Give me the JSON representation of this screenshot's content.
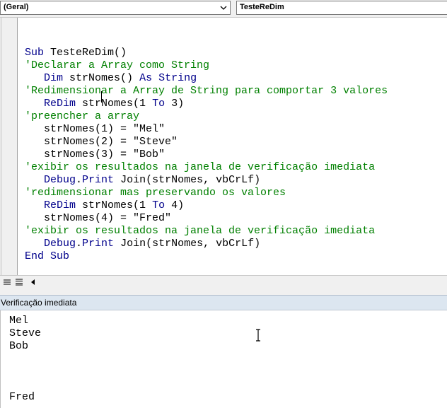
{
  "toolbar": {
    "object_combo": "(Geral)",
    "procedure_combo": "TesteReDim"
  },
  "code_lines": [
    [
      {
        "t": "Sub ",
        "c": "kw"
      },
      {
        "t": "TesteReDim()",
        "c": "pl"
      }
    ],
    [
      {
        "t": "'Declarar a Array como String",
        "c": "cm"
      }
    ],
    [
      {
        "t": "   ",
        "c": "pl"
      },
      {
        "t": "Dim ",
        "c": "kw"
      },
      {
        "t": "strNomes() ",
        "c": "pl"
      },
      {
        "t": "As String",
        "c": "kw"
      }
    ],
    [
      {
        "t": "'Redimensionar a Array de String para comportar 3 valores",
        "c": "cm"
      }
    ],
    [
      {
        "t": "   ",
        "c": "pl"
      },
      {
        "t": "ReDim ",
        "c": "kw"
      },
      {
        "t": "strNomes(1 ",
        "c": "pl"
      },
      {
        "t": "To ",
        "c": "kw"
      },
      {
        "t": "3)",
        "c": "pl"
      }
    ],
    [
      {
        "t": "'preencher a array",
        "c": "cm"
      }
    ],
    [
      {
        "t": "   strNomes(1) = \"Mel\"",
        "c": "pl"
      }
    ],
    [
      {
        "t": "   strNomes(2) = \"Steve\"",
        "c": "pl"
      }
    ],
    [
      {
        "t": "   strNomes(3) = \"Bob\"",
        "c": "pl"
      }
    ],
    [
      {
        "t": "'exibir os resultados na janela de verificação imediata",
        "c": "cm"
      }
    ],
    [
      {
        "t": "   ",
        "c": "pl"
      },
      {
        "t": "Debug",
        "c": "kw"
      },
      {
        "t": ".",
        "c": "pl"
      },
      {
        "t": "Print ",
        "c": "kw"
      },
      {
        "t": "Join(strNomes, vbCrLf)",
        "c": "pl"
      }
    ],
    [
      {
        "t": "'redimensionar mas preservando os valores",
        "c": "cm"
      }
    ],
    [
      {
        "t": "   ",
        "c": "pl"
      },
      {
        "t": "ReDim ",
        "c": "kw"
      },
      {
        "t": "strNomes(1 ",
        "c": "pl"
      },
      {
        "t": "To ",
        "c": "kw"
      },
      {
        "t": "4)",
        "c": "pl"
      }
    ],
    [
      {
        "t": "   strNomes(4) = \"Fred\"",
        "c": "pl"
      }
    ],
    [
      {
        "t": "'exibir os resultados na janela de verificação imediata",
        "c": "cm"
      }
    ],
    [
      {
        "t": "   ",
        "c": "pl"
      },
      {
        "t": "Debug",
        "c": "kw"
      },
      {
        "t": ".",
        "c": "pl"
      },
      {
        "t": "Print ",
        "c": "kw"
      },
      {
        "t": "Join(strNomes, vbCrLf)",
        "c": "pl"
      }
    ],
    [
      {
        "t": "End Sub",
        "c": "kw"
      }
    ]
  ],
  "immediate": {
    "title": "Verificação imediata",
    "lines": [
      "Mel",
      "Steve",
      "Bob",
      "",
      "",
      "",
      "Fred"
    ]
  },
  "colors": {
    "keyword": "#00008b",
    "comment": "#008000",
    "text": "#000000"
  },
  "icons": {
    "combo_arrow": "chevron-down-icon",
    "procedure_view": "procedure-view-icon",
    "module_view": "full-module-view-icon",
    "scroll_left": "triangle-left-icon",
    "cursor": "ibeam-cursor-icon"
  }
}
